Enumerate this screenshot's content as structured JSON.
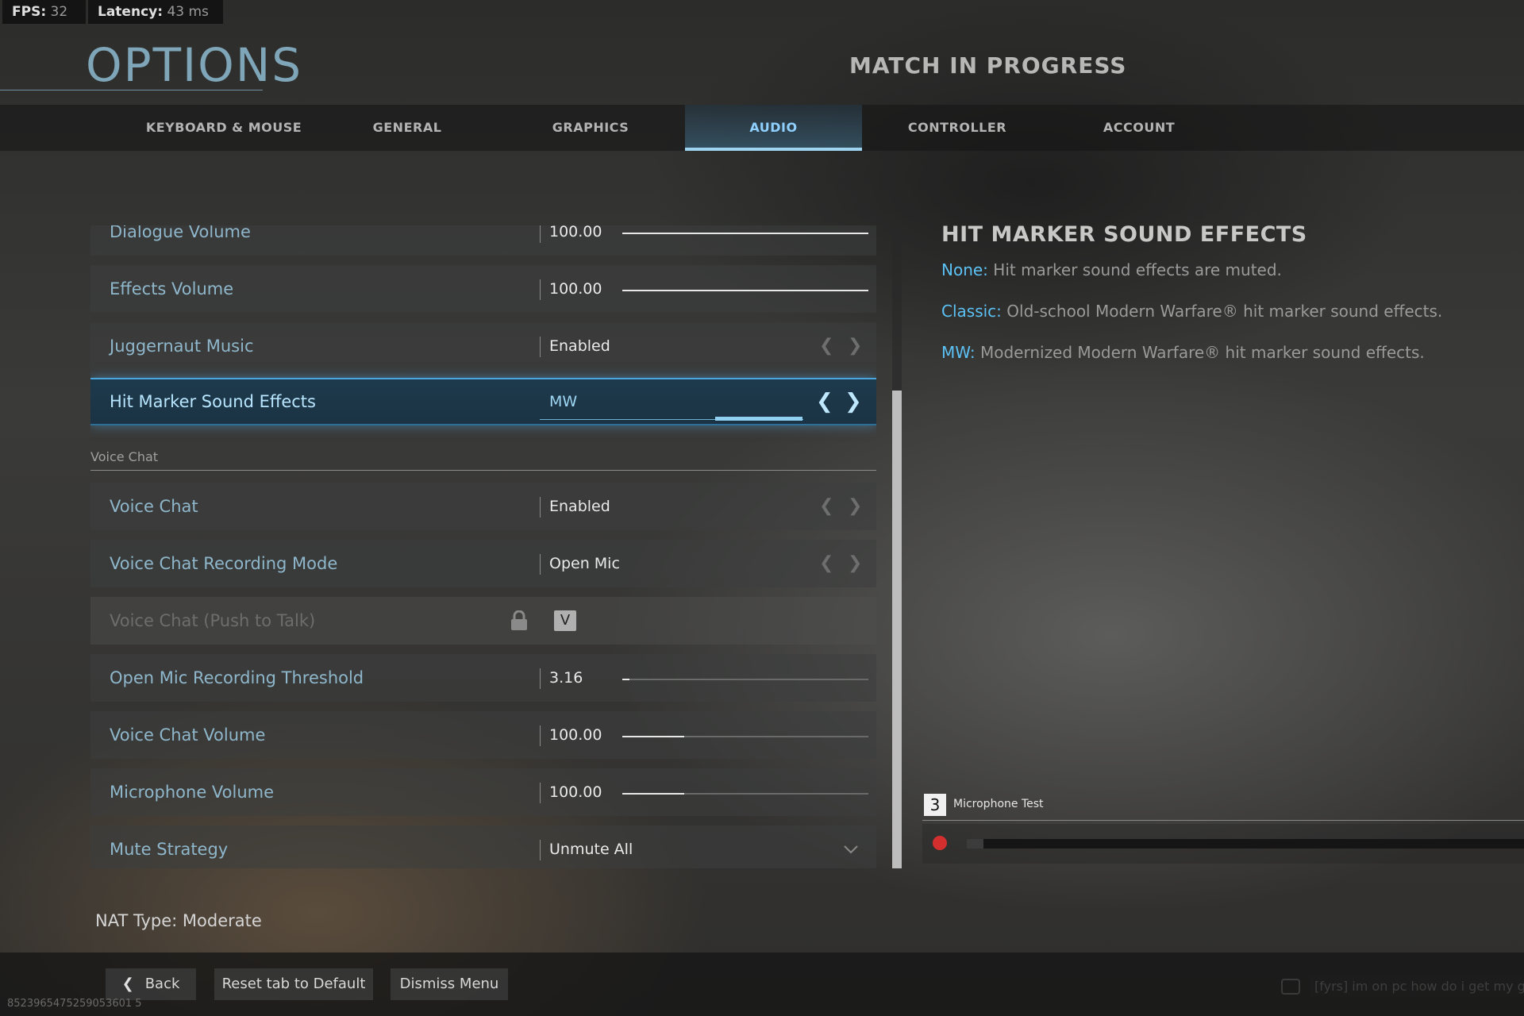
{
  "hud": {
    "fps_label": "FPS:",
    "fps_value": "32",
    "latency_label": "Latency:",
    "latency_value": "43 ms"
  },
  "header": {
    "title": "OPTIONS",
    "status": "MATCH IN PROGRESS"
  },
  "tabs": [
    {
      "label": "KEYBOARD & MOUSE",
      "active": false
    },
    {
      "label": "GENERAL",
      "active": false
    },
    {
      "label": "GRAPHICS",
      "active": false
    },
    {
      "label": "AUDIO",
      "active": true
    },
    {
      "label": "CONTROLLER",
      "active": false
    },
    {
      "label": "ACCOUNT",
      "active": false
    }
  ],
  "settings": {
    "dialogue_volume": {
      "label": "Dialogue Volume",
      "value": "100.00",
      "level": 1.0
    },
    "effects_volume": {
      "label": "Effects Volume",
      "value": "100.00",
      "level": 1.0
    },
    "juggernaut_music": {
      "label": "Juggernaut Music",
      "value": "Enabled"
    },
    "hit_marker": {
      "label": "Hit Marker Sound Effects",
      "value": "MW"
    },
    "voice_chat_section": "Voice Chat",
    "voice_chat": {
      "label": "Voice Chat",
      "value": "Enabled"
    },
    "recording_mode": {
      "label": "Voice Chat Recording Mode",
      "value": "Open Mic"
    },
    "push_to_talk": {
      "label": "Voice Chat (Push to Talk)",
      "key": "V",
      "locked": true
    },
    "open_mic_threshold": {
      "label": "Open Mic Recording Threshold",
      "value": "3.16",
      "level": 0.03
    },
    "voice_chat_volume": {
      "label": "Voice Chat Volume",
      "value": "100.00",
      "level": 0.25
    },
    "microphone_volume": {
      "label": "Microphone Volume",
      "value": "100.00",
      "level": 0.25
    },
    "mute_strategy": {
      "label": "Mute Strategy",
      "value": "Unmute All"
    }
  },
  "description": {
    "title": "HIT MARKER SOUND EFFECTS",
    "items": [
      {
        "key": "None:",
        "text": " Hit marker sound effects are muted."
      },
      {
        "key": "Classic:",
        "text": " Old-school Modern Warfare® hit marker sound effects."
      },
      {
        "key": "MW:",
        "text": " Modernized Modern Warfare® hit marker sound effects."
      }
    ]
  },
  "microphone_test": {
    "key": "3",
    "label": "Microphone Test",
    "level": 0.03
  },
  "nat": "NAT Type: Moderate",
  "footer": {
    "back": "Back",
    "reset": "Reset tab to Default",
    "dismiss": "Dismiss Menu",
    "session_id": "8523965475259053601 5",
    "chat_preview": "[fyrs] im on pc how do i get my gam"
  },
  "colors": {
    "accent": "#5cc2f5",
    "title": "#7fa6b8",
    "record": "#d32f2f"
  }
}
